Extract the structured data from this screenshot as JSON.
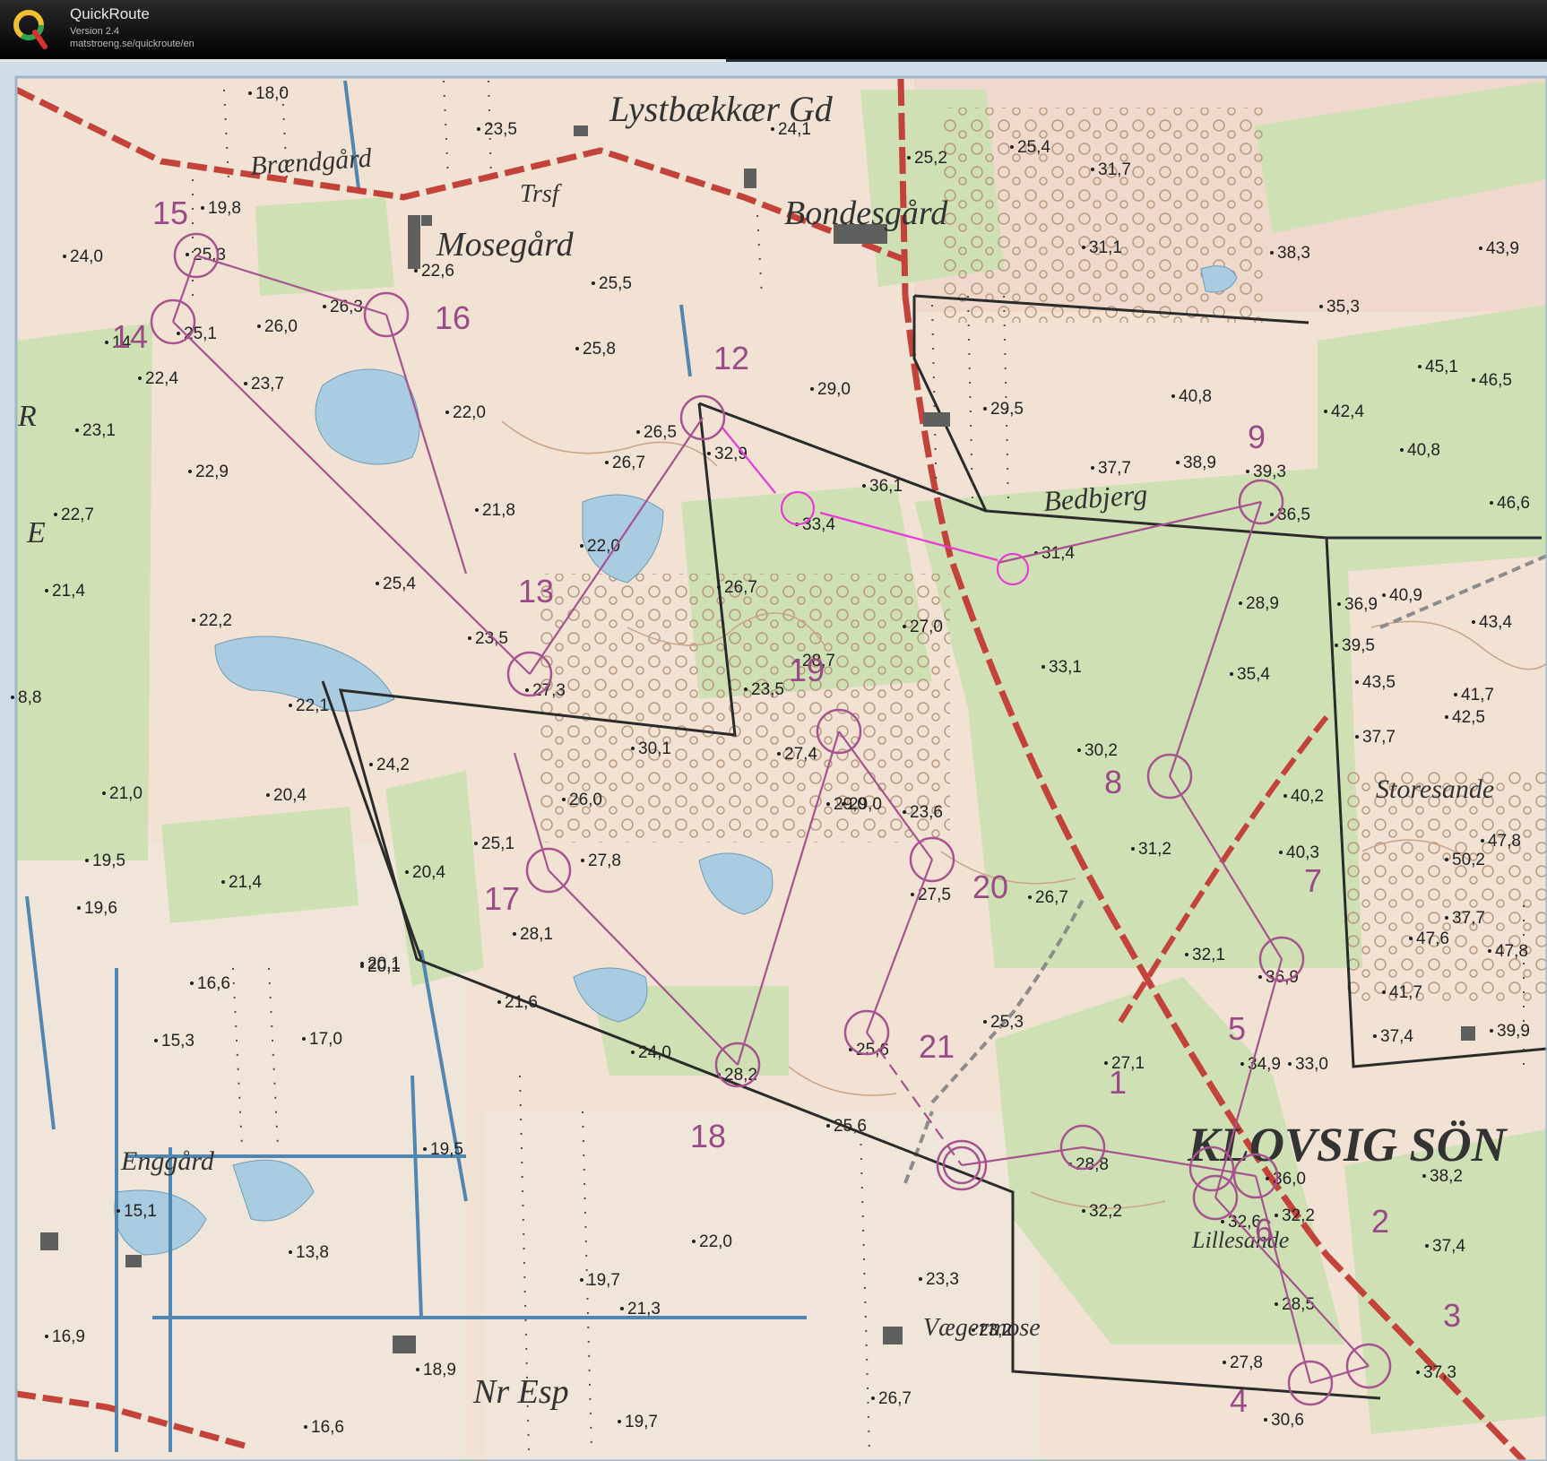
{
  "app": {
    "name": "QuickRoute",
    "version": "Version 2.4",
    "url": "matstroeng.se/quickroute/en"
  },
  "colors": {
    "open_land": "#ecd6c8",
    "forest": "#cfe0b4",
    "water": "#a9cce0",
    "course": "#a6538f",
    "route": "#e83ad6",
    "road": "#c3423a",
    "border": "#2b2b2b"
  },
  "place_names": {
    "lystbaekkaer": "Lystbækkær Gd",
    "braendgaard": "Brændgård",
    "trsf": "Trsf",
    "mosegaard": "Mosegård",
    "bondesgaard": "Bondesgård",
    "bedbjerg": "Bedbjerg",
    "storesande": "Storesande",
    "klovsig": "KLOVSIG SÖN",
    "lillesande": "Lillesande",
    "enggaard": "Enggård",
    "vaegermose": "Vægermose",
    "nr_esp": "Nr Esp",
    "edge_r": "R",
    "edge_e": "E"
  },
  "controls": [
    {
      "label": "1"
    },
    {
      "label": "2"
    },
    {
      "label": "3"
    },
    {
      "label": "4"
    },
    {
      "label": "5"
    },
    {
      "label": "6"
    },
    {
      "label": "7"
    },
    {
      "label": "8"
    },
    {
      "label": "9"
    },
    {
      "label": "12"
    },
    {
      "label": "13"
    },
    {
      "label": "14"
    },
    {
      "label": "15"
    },
    {
      "label": "16"
    },
    {
      "label": "17"
    },
    {
      "label": "18"
    },
    {
      "label": "19"
    },
    {
      "label": "20"
    },
    {
      "label": "21"
    }
  ],
  "spot_heights": [
    "18,0",
    "23,5",
    "24,1",
    "25,2",
    "25,4",
    "31,7",
    "19,8",
    "24,0",
    "25,3",
    "22,6",
    "25,5",
    "31,1",
    "38,3",
    "43,9",
    "35,3",
    "14",
    "25,1",
    "26,0",
    "26,3",
    "25,8",
    "45,1",
    "46,5",
    "22,4",
    "23,7",
    "22,0",
    "29,0",
    "29,5",
    "40,8",
    "42,4",
    "23,1",
    "26,5",
    "32,9",
    "40,8",
    "22,9",
    "26,7",
    "36,1",
    "37,7",
    "38,9",
    "39,3",
    "21,8",
    "33,4",
    "36,5",
    "46,6",
    "22,7",
    "22,0",
    "31,4",
    "40,9",
    "21,4",
    "25,4",
    "26,7",
    "27,0",
    "28,9",
    "36,9",
    "43,4",
    "22,2",
    "23,5",
    "28,7",
    "33,1",
    "35,4",
    "39,5",
    "8,8",
    "22,1",
    "27,3",
    "23,5",
    "43,5",
    "41,7",
    "42,5",
    "30,1",
    "27,4",
    "30,2",
    "37,7",
    "24,2",
    "29,0",
    "21,0",
    "20,4",
    "26,0",
    "29,0",
    "23,6",
    "40,2",
    "25,1",
    "27,8",
    "31,2",
    "40,3",
    "47,8",
    "19,5",
    "21,4",
    "20,4",
    "27,5",
    "26,7",
    "50,2",
    "19,6",
    "28,1",
    "20,1",
    "32,1",
    "36,9",
    "47,8",
    "47,6",
    "37,7",
    "20,1",
    "16,6",
    "21,6",
    "41,7",
    "17,0",
    "15,3",
    "24,0",
    "28,2",
    "25,6",
    "25,3",
    "37,4",
    "39,9",
    "27,1",
    "34,9",
    "33,0",
    "25,6",
    "19,5",
    "28,8",
    "36,0",
    "38,2",
    "15,1",
    "32,2",
    "32,6",
    "32,2",
    "37,4",
    "13,8",
    "22,0",
    "23,3",
    "19,7",
    "21,3",
    "28,5",
    "23,2",
    "16,9",
    "18,9",
    "27,8",
    "37,3",
    "26,7",
    "30,6",
    "16,6",
    "19,7"
  ]
}
